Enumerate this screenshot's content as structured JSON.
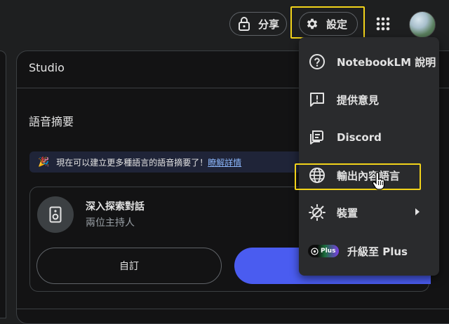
{
  "topbar": {
    "share_label": "分享",
    "settings_label": "設定"
  },
  "studio": {
    "title": "Studio",
    "audio_overview_title": "語音摘要",
    "banner": {
      "text": "現在可以建立更多種語言的語音摘要了！",
      "link": "瞭解詳情"
    },
    "card": {
      "title": "深入探索對話",
      "subtitle": "兩位主持人",
      "customize_label": "自訂"
    }
  },
  "menu": {
    "items": [
      {
        "label": "NotebookLM 說明",
        "icon": "help-circle-icon"
      },
      {
        "label": "提供意見",
        "icon": "feedback-icon"
      },
      {
        "label": "Discord",
        "icon": "discord-icon"
      },
      {
        "label": "輸出內容語言",
        "icon": "globe-icon"
      },
      {
        "label": "裝置",
        "icon": "device-icon"
      },
      {
        "label": "升級至 Plus",
        "icon": "plus-badge",
        "badge": "Plus"
      }
    ]
  },
  "colors": {
    "highlight": "#f2d31a",
    "accent": "#4a5cf0",
    "link": "#8ab4f8"
  }
}
